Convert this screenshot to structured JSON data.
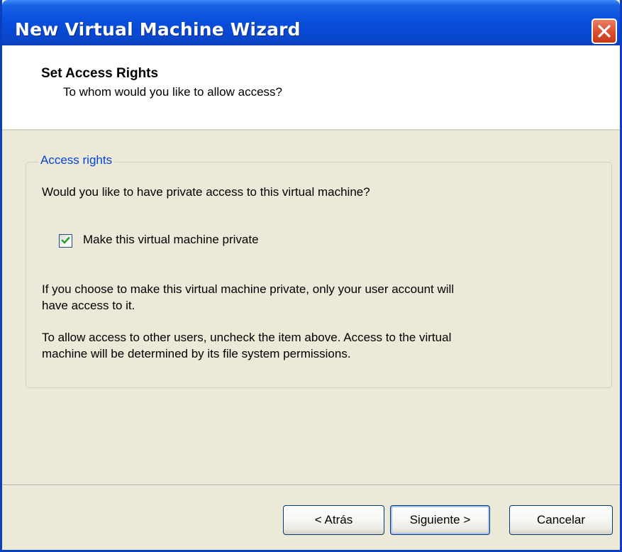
{
  "window": {
    "title": "New Virtual Machine Wizard",
    "close_icon": "close-icon"
  },
  "header": {
    "title": "Set Access Rights",
    "subtitle": "To whom would you like to allow access?"
  },
  "access_group": {
    "legend": "Access rights",
    "question": "Would you like to have private access to this virtual machine?",
    "checkbox": {
      "label": "Make this virtual machine private",
      "checked": true
    },
    "info_private_line1": "If you choose to make this virtual machine private, only your user account will",
    "info_private_line2": "have access to it.",
    "info_uncheck_line1": "To allow access to other users, uncheck the item above. Access to the virtual",
    "info_uncheck_line2": "machine will be determined by its file system permissions."
  },
  "buttons": {
    "back": "< Atrás",
    "next": "Siguiente >",
    "cancel": "Cancelar"
  },
  "colors": {
    "titlebar": "#0a52de",
    "legend": "#0046d5",
    "checkmark": "#21a121"
  }
}
